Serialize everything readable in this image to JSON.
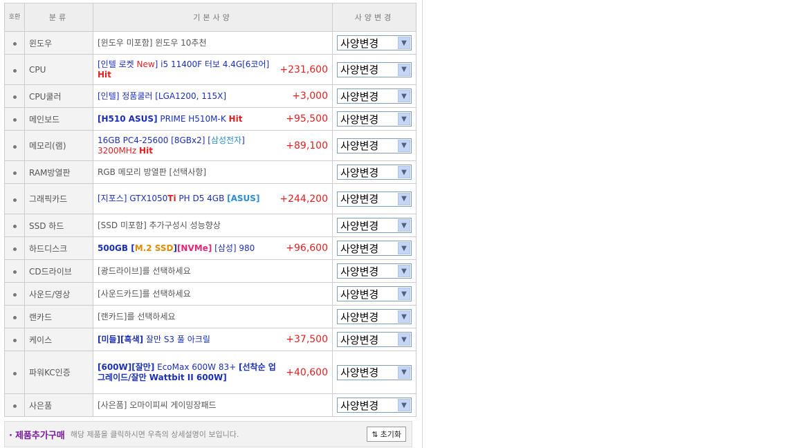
{
  "header": {
    "col_no": "호환",
    "col_category": "분류",
    "col_spec": "기본사양",
    "col_change": "사양변경"
  },
  "select_label": "사양변경",
  "rows": [
    {
      "category": "윈도우",
      "parts": [
        [
          "gray",
          "[윈도우 미포함] 윈도우 10추천"
        ]
      ],
      "price": ""
    },
    {
      "category": "CPU",
      "parts": [
        [
          "blue",
          "[인텔 로켓 "
        ],
        [
          "redn",
          "New"
        ],
        [
          "blue",
          "] i5 11400F 터보 4.4G[6코어] "
        ],
        [
          "red",
          "Hit"
        ]
      ],
      "price": "+231,600"
    },
    {
      "category": "CPU쿨러",
      "parts": [
        [
          "blue",
          "[인텔] 정품쿨러 [LGA1200, 115X]"
        ]
      ],
      "price": "+3,000"
    },
    {
      "category": "메인보드",
      "parts": [
        [
          "blue b",
          "[H510 ASUS]"
        ],
        [
          "blue",
          " PRIME H510M-K "
        ],
        [
          "red",
          "Hit"
        ]
      ],
      "price": "+95,500"
    },
    {
      "category": "메모리(램)",
      "parts": [
        [
          "blue",
          "16GB PC4-25600 [8GBx2] ["
        ],
        [
          "lblue",
          "삼성전자"
        ],
        [
          "blue",
          "] "
        ],
        [
          "redn",
          "3200MHz "
        ],
        [
          "red",
          "Hit"
        ]
      ],
      "price": "+89,100"
    },
    {
      "category": "RAM방열판",
      "parts": [
        [
          "gray",
          "RGB 메모리 방열판 [선택사항]"
        ]
      ],
      "price": ""
    },
    {
      "category": "그래픽카드",
      "parts": [
        [
          "blue",
          "[지포스] GTX1050"
        ],
        [
          "red",
          "Ti"
        ],
        [
          "blue",
          " PH D5 4GB "
        ],
        [
          "lblue b",
          "[ASUS]"
        ]
      ],
      "price": "+244,200"
    },
    {
      "category": "SSD 하드",
      "parts": [
        [
          "gray",
          "[SSD 미포함] 추가구성시 성능향상"
        ]
      ],
      "price": ""
    },
    {
      "category": "하드디스크",
      "parts": [
        [
          "blue b",
          "500GB ["
        ],
        [
          "orange b",
          "M.2 SSD"
        ],
        [
          "blue b",
          "]"
        ],
        [
          "pink b",
          "[NVMe]"
        ],
        [
          "blue",
          " [삼성] 980"
        ]
      ],
      "price": "+96,600"
    },
    {
      "category": "CD드라이브",
      "parts": [
        [
          "gray",
          "[광드라이브]를 선택하세요"
        ]
      ],
      "price": ""
    },
    {
      "category": "사운드/영상",
      "parts": [
        [
          "gray",
          "[사운드카드]를 선택하세요"
        ]
      ],
      "price": ""
    },
    {
      "category": "랜카드",
      "parts": [
        [
          "gray",
          "[랜카드]를 선택하세요"
        ]
      ],
      "price": ""
    },
    {
      "category": "케이스",
      "parts": [
        [
          "blue b",
          "[미들][흑색]"
        ],
        [
          "blue",
          " 잘만 S3 풀 아크릴"
        ]
      ],
      "price": "+37,500"
    },
    {
      "category": "파워KC인증",
      "parts": [
        [
          "blue b",
          "[600W][잘만]"
        ],
        [
          "blue",
          " EcoMax 600W 83+ "
        ],
        [
          "blue b",
          "[선착순 업그레이드/잘만 Wattbit II 600W]"
        ]
      ],
      "price": "+40,600"
    },
    {
      "category": "사은품",
      "parts": [
        [
          "gray",
          "[사은품] 오마이피씨 게이밍장패드"
        ]
      ],
      "price": ""
    }
  ],
  "footer": {
    "title": "제품추가구매",
    "note": "해당 제품을 클릭하시면 우측의 상세설명이 보입니다.",
    "reset_label": "초기화",
    "reset_icon": "up-down-arrows-icon"
  }
}
